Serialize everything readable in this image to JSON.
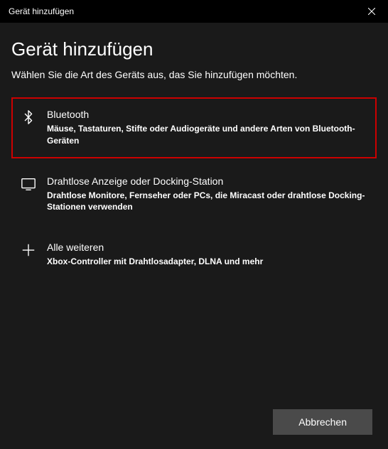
{
  "titlebar": {
    "title": "Gerät hinzufügen"
  },
  "heading": "Gerät hinzufügen",
  "subheading": "Wählen Sie die Art des Geräts aus, das Sie hinzufügen möchten.",
  "options": [
    {
      "title": "Bluetooth",
      "description": "Mäuse, Tastaturen, Stifte oder Audiogeräte und andere Arten von Bluetooth-Geräten"
    },
    {
      "title": "Drahtlose Anzeige oder Docking-Station",
      "description": "Drahtlose Monitore, Fernseher oder PCs, die Miracast oder drahtlose Docking-Stationen verwenden"
    },
    {
      "title": "Alle weiteren",
      "description": "Xbox-Controller mit Drahtlosadapter, DLNA und mehr"
    }
  ],
  "footer": {
    "cancel_label": "Abbrechen"
  }
}
